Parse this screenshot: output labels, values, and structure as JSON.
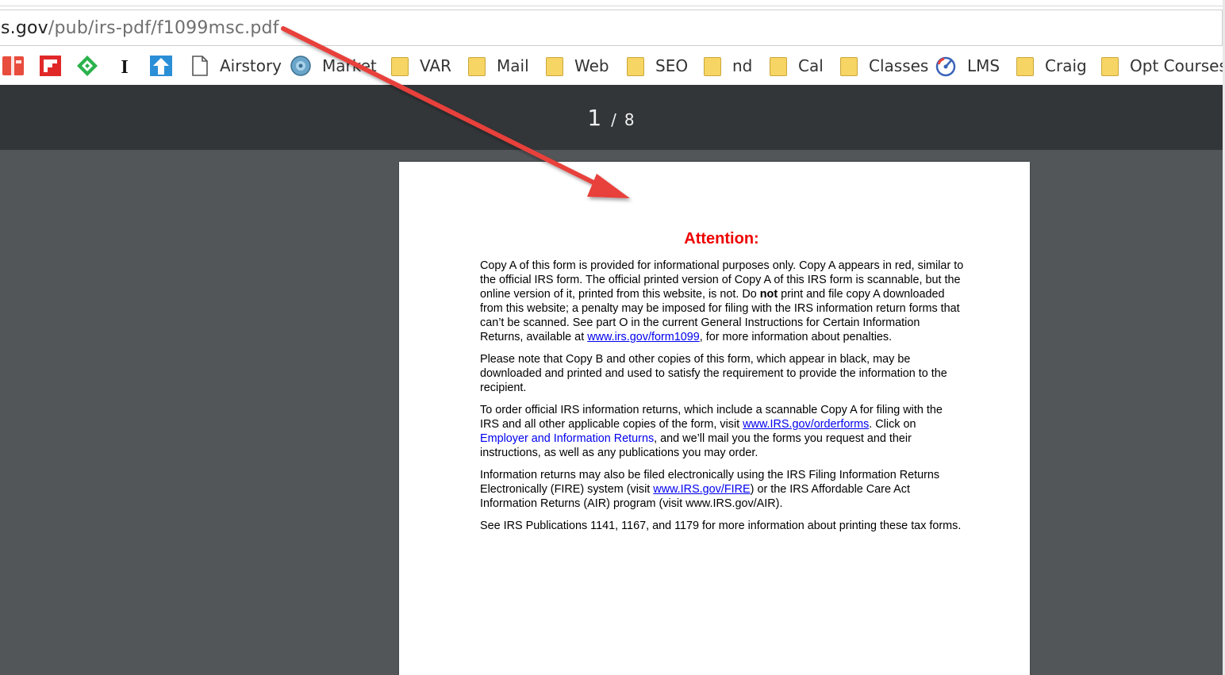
{
  "address_bar": {
    "url_host": "s.gov",
    "url_path": "/pub/irs-pdf/f1099msc.pdf"
  },
  "bookmarks": [
    {
      "kind": "favicon",
      "icon": "app-red-icon",
      "label": ""
    },
    {
      "kind": "favicon",
      "icon": "flipboard-icon",
      "label": ""
    },
    {
      "kind": "favicon",
      "icon": "feedly-icon",
      "label": ""
    },
    {
      "kind": "favicon",
      "icon": "instapaper-icon",
      "label": ""
    },
    {
      "kind": "favicon",
      "icon": "upload-arrow-icon",
      "label": ""
    },
    {
      "kind": "page",
      "icon": "page-icon",
      "label": "Airstory"
    },
    {
      "kind": "favicon",
      "icon": "globe-icon",
      "label": "Market"
    },
    {
      "kind": "folder",
      "icon": "folder-icon",
      "label": "VAR"
    },
    {
      "kind": "folder",
      "icon": "folder-icon",
      "label": "Mail"
    },
    {
      "kind": "folder",
      "icon": "folder-icon",
      "label": "Web"
    },
    {
      "kind": "folder",
      "icon": "folder-icon",
      "label": "SEO"
    },
    {
      "kind": "folder",
      "icon": "folder-icon",
      "label": "nd"
    },
    {
      "kind": "folder",
      "icon": "folder-icon",
      "label": "Cal"
    },
    {
      "kind": "folder",
      "icon": "folder-icon",
      "label": "Classes"
    },
    {
      "kind": "favicon",
      "icon": "lms-gauge-icon",
      "label": "LMS"
    },
    {
      "kind": "folder",
      "icon": "folder-icon",
      "label": "Craig"
    },
    {
      "kind": "folder",
      "icon": "folder-icon",
      "label": "Opt Courses"
    }
  ],
  "pdf_toolbar": {
    "current_page": "1",
    "separator": "/",
    "total_pages": "8"
  },
  "pdf_page": {
    "title": "Attention:",
    "p1": {
      "a": "Copy A of this form is provided for informational purposes only. Copy A appears in red, similar to the official IRS form. The official printed version of Copy A of this IRS form is scannable, but the online version of it, printed from this website, is not. Do ",
      "bold": "not",
      "b": " print and file copy A downloaded from this website; a penalty may be imposed for filing with the IRS information return forms that can’t be scanned. See part O in the current General Instructions for Certain Information Returns, available at ",
      "link": "www.irs.gov/form1099",
      "c": ", for more information about penalties."
    },
    "p2": "Please note that Copy B and other copies of this form, which appear in black, may be downloaded and printed and used to satisfy the requirement to provide the information to the recipient.",
    "p3": {
      "a": "To order official IRS information returns, which include a scannable Copy A for filing with the IRS and all other applicable copies of the form, visit ",
      "link1": "www.IRS.gov/orderforms",
      "b": ". Click on ",
      "link2": "Employer and Information Returns",
      "c": ", and we’ll mail you the forms you request and their instructions, as well as any publications you may order."
    },
    "p4": {
      "a": "Information returns may also be filed electronically using the IRS Filing Information Returns Electronically (FIRE) system (visit ",
      "link": "www.IRS.gov/FIRE",
      "b": ") or the IRS Affordable Care Act Information Returns (AIR) program (visit www.IRS.gov/AIR)."
    },
    "p5": "See IRS Publications 1141, 1167, and 1179 for more information about printing these tax forms."
  },
  "colors": {
    "toolbar_bg": "#323639",
    "viewport_bg": "#525659",
    "attention_red": "#ee0000",
    "link_blue": "#0000ee",
    "arrow_red": "#e8413a",
    "folder_yellow": "#f7d564"
  }
}
